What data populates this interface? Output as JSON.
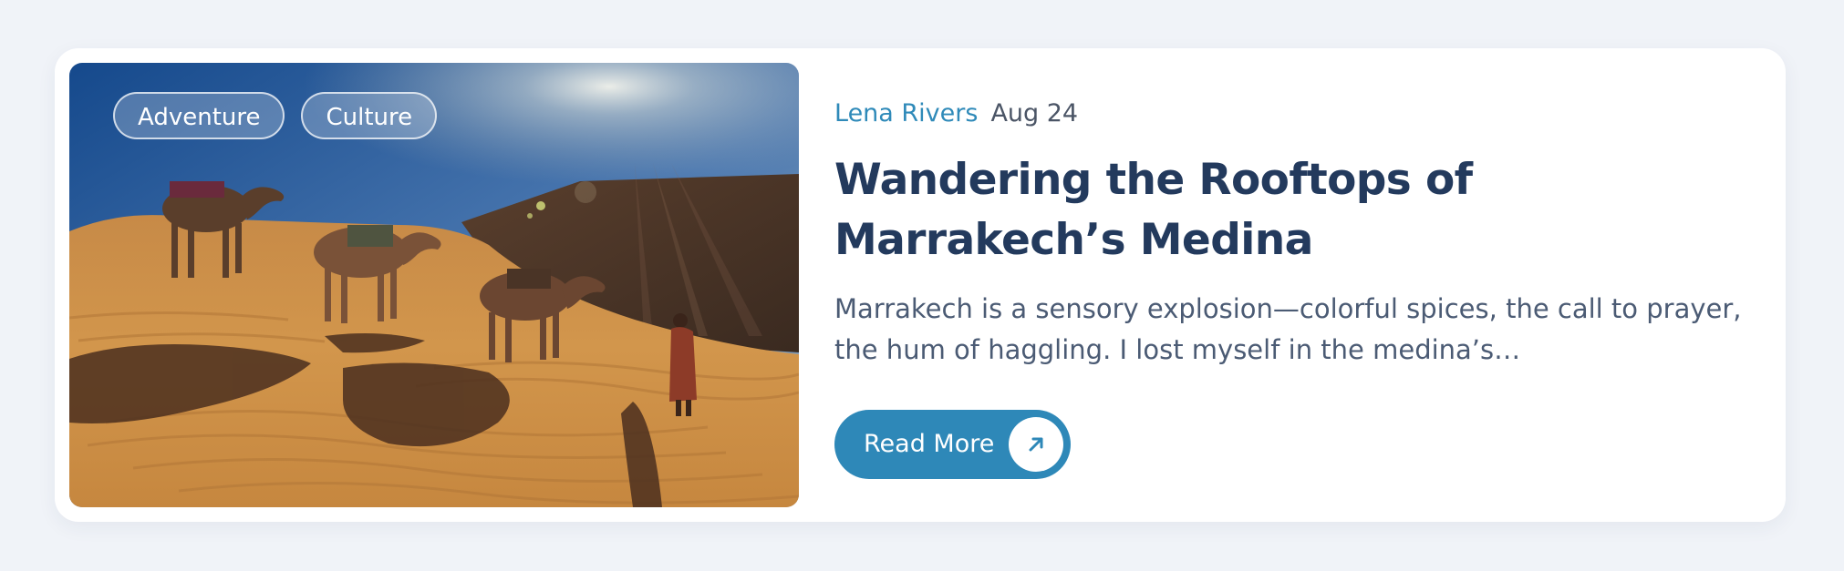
{
  "card": {
    "image_alt": "Camel caravan crossing desert dunes",
    "tags": [
      "Adventure",
      "Culture"
    ],
    "author": "Lena Rivers",
    "date": "Aug 24",
    "title": "Wandering the Rooftops of Marrakech’s Medina",
    "excerpt": "Marrakech is a sensory explosion—colorful spices, the call to prayer, the hum of haggling. I lost myself in the medina’s…",
    "cta": {
      "label": "Read More",
      "icon": "arrow-up-right-icon"
    }
  },
  "colors": {
    "page_background": "#f0f3f8",
    "card_background": "#ffffff",
    "accent": "#2e88b8",
    "author": "#2f8ab9",
    "title": "#233a5d",
    "body_text": "#4b5b74"
  }
}
